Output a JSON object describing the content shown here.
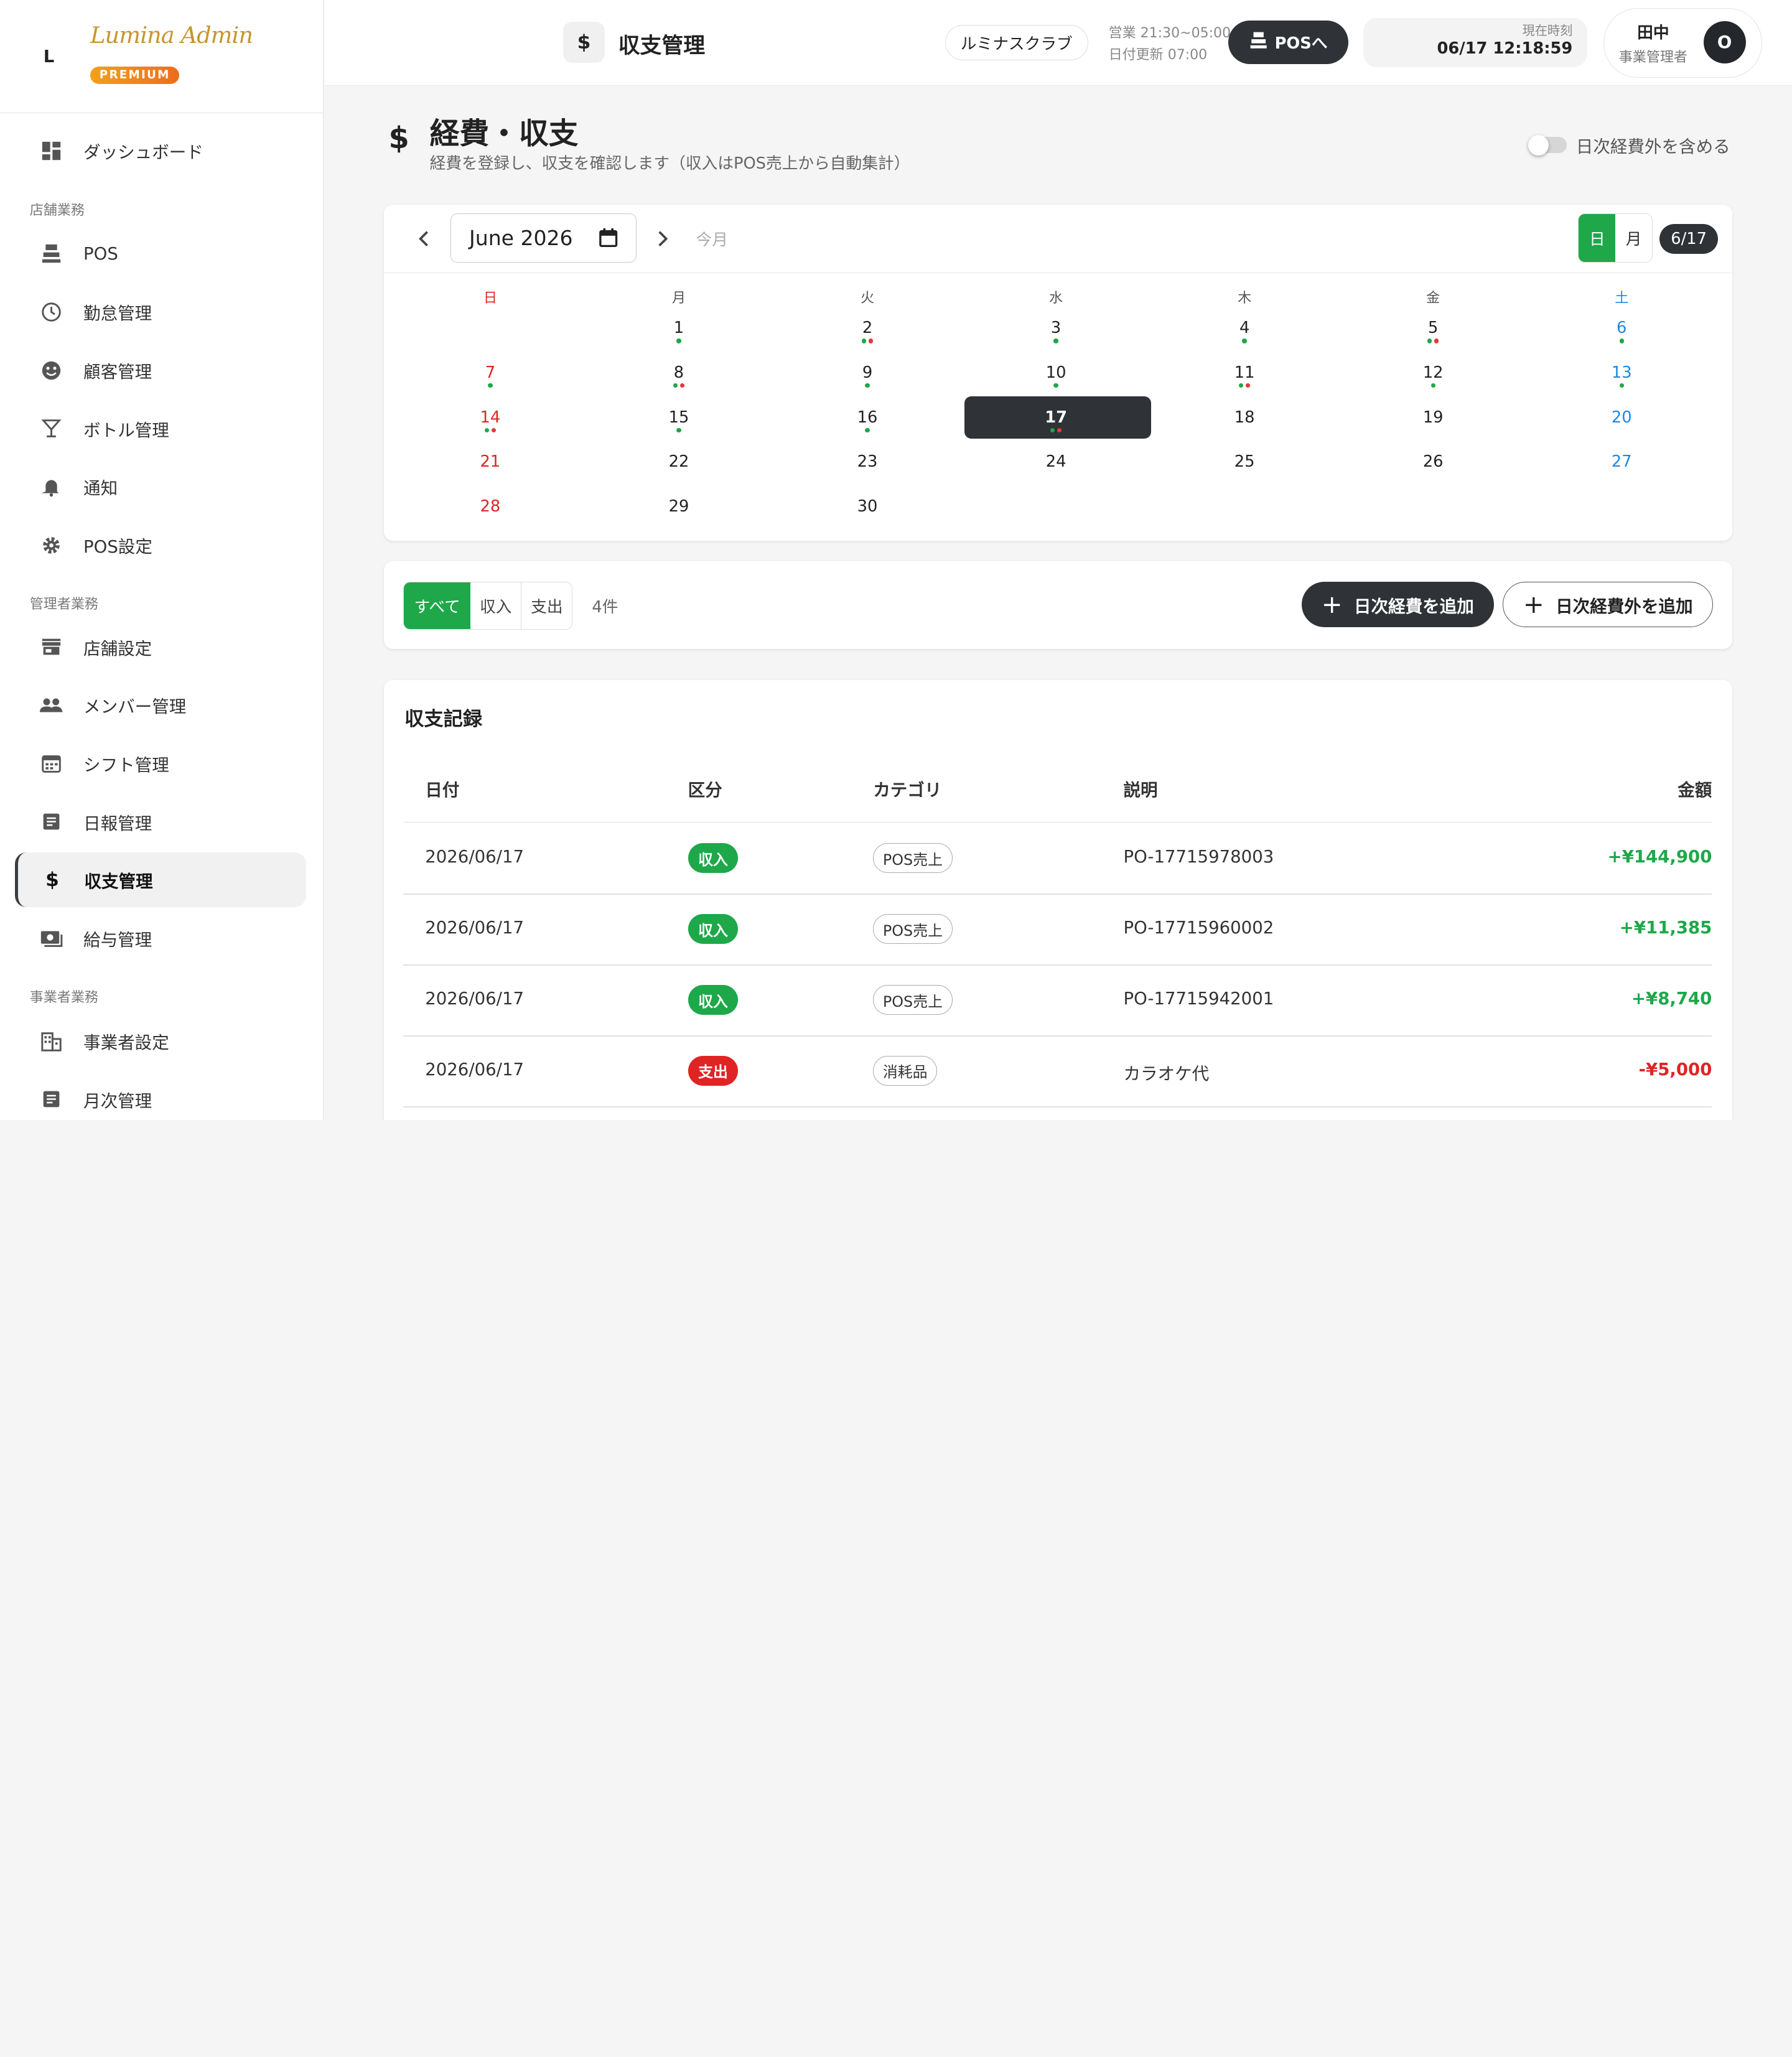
{
  "brand": {
    "mono": "L",
    "script": "Lumina Admin",
    "badge": "PREMIUM"
  },
  "sidebar": {
    "dashboard": "ダッシュボード",
    "section1": "店舗業務",
    "pos": "POS",
    "attendance": "勤怠管理",
    "customers": "顧客管理",
    "bottles": "ボトル管理",
    "notifications": "通知",
    "pos_settings": "POS設定",
    "section2": "管理者業務",
    "store_settings": "店舗設定",
    "members": "メンバー管理",
    "shifts": "シフト管理",
    "daily_reports": "日報管理",
    "finance": "収支管理",
    "payroll": "給与管理",
    "section3": "事業者業務",
    "business_settings": "事業者設定",
    "monthly": "月次管理"
  },
  "topbar": {
    "icon": "$",
    "title": "収支管理",
    "club": "ルミナスクラブ",
    "hours": "営業 21:30~05:00",
    "date_update": "日付更新 07:00",
    "pos_button": "POSへ",
    "clock_label": "現在時刻",
    "clock_value": "06/17 12:18:59",
    "user_name": "田中",
    "user_role": "事業管理者",
    "avatar": "O"
  },
  "page": {
    "icon": "$",
    "title": "経費・収支",
    "subtitle": "経費を登録し、収支を確認します（収入はPOS売上から自動集計）",
    "toggle_label": "日次経費外を含める",
    "toggle_on": false
  },
  "calendar": {
    "month": "June 2026",
    "today_label": "今月",
    "view_day": "日",
    "view_month": "月",
    "view_selected": "日",
    "selected_badge": "6/17",
    "weekdays": [
      "日",
      "月",
      "火",
      "水",
      "木",
      "金",
      "土"
    ],
    "weeks": [
      [
        null,
        {
          "d": "1",
          "dots": [
            "g"
          ]
        },
        {
          "d": "2",
          "dots": [
            "g",
            "r"
          ]
        },
        {
          "d": "3",
          "dots": [
            "g"
          ]
        },
        {
          "d": "4",
          "dots": [
            "g"
          ]
        },
        {
          "d": "5",
          "dots": [
            "g",
            "r"
          ]
        },
        {
          "d": "6",
          "dots": [
            "g"
          ]
        }
      ],
      [
        {
          "d": "7",
          "dots": [
            "g"
          ]
        },
        {
          "d": "8",
          "dots": [
            "g",
            "r"
          ]
        },
        {
          "d": "9",
          "dots": [
            "g"
          ]
        },
        {
          "d": "10",
          "dots": [
            "g"
          ]
        },
        {
          "d": "11",
          "dots": [
            "g",
            "r"
          ]
        },
        {
          "d": "12",
          "dots": [
            "g"
          ]
        },
        {
          "d": "13",
          "dots": [
            "g"
          ]
        }
      ],
      [
        {
          "d": "14",
          "dots": [
            "g",
            "r"
          ]
        },
        {
          "d": "15",
          "dots": [
            "g"
          ]
        },
        {
          "d": "16",
          "dots": [
            "g"
          ]
        },
        {
          "d": "17",
          "dots": [
            "g",
            "r"
          ],
          "selected": true
        },
        {
          "d": "18",
          "dots": []
        },
        {
          "d": "19",
          "dots": []
        },
        {
          "d": "20",
          "dots": []
        }
      ],
      [
        {
          "d": "21",
          "dots": []
        },
        {
          "d": "22",
          "dots": []
        },
        {
          "d": "23",
          "dots": []
        },
        {
          "d": "24",
          "dots": []
        },
        {
          "d": "25",
          "dots": []
        },
        {
          "d": "26",
          "dots": []
        },
        {
          "d": "27",
          "dots": []
        }
      ],
      [
        {
          "d": "28",
          "dots": []
        },
        {
          "d": "29",
          "dots": []
        },
        {
          "d": "30",
          "dots": []
        },
        null,
        null,
        null,
        null
      ]
    ]
  },
  "filters": {
    "all": "すべて",
    "income": "収入",
    "expense": "支出",
    "active": "すべて",
    "count": "4件",
    "add_daily": "日次経費を追加",
    "add_other": "日次経費外を追加"
  },
  "table": {
    "title": "収支記録",
    "headers": [
      "日付",
      "区分",
      "カテゴリ",
      "説明",
      "金額"
    ],
    "rows": [
      {
        "date": "2026/06/17",
        "type": "収入",
        "category": "POS売上",
        "description": "PO-17715978003",
        "amount": "+¥144,900"
      },
      {
        "date": "2026/06/17",
        "type": "収入",
        "category": "POS売上",
        "description": "PO-17715960002",
        "amount": "+¥11,385"
      },
      {
        "date": "2026/06/17",
        "type": "収入",
        "category": "POS売上",
        "description": "PO-17715942001",
        "amount": "+¥8,740"
      },
      {
        "date": "2026/06/17",
        "type": "支出",
        "category": "消耗品",
        "description": "カラオケ代",
        "amount": "-¥5,000"
      }
    ]
  },
  "colors": {
    "accent": "#1ea84a",
    "expense": "#e02424",
    "dark": "#2f3337",
    "gold": "#c8952c"
  }
}
